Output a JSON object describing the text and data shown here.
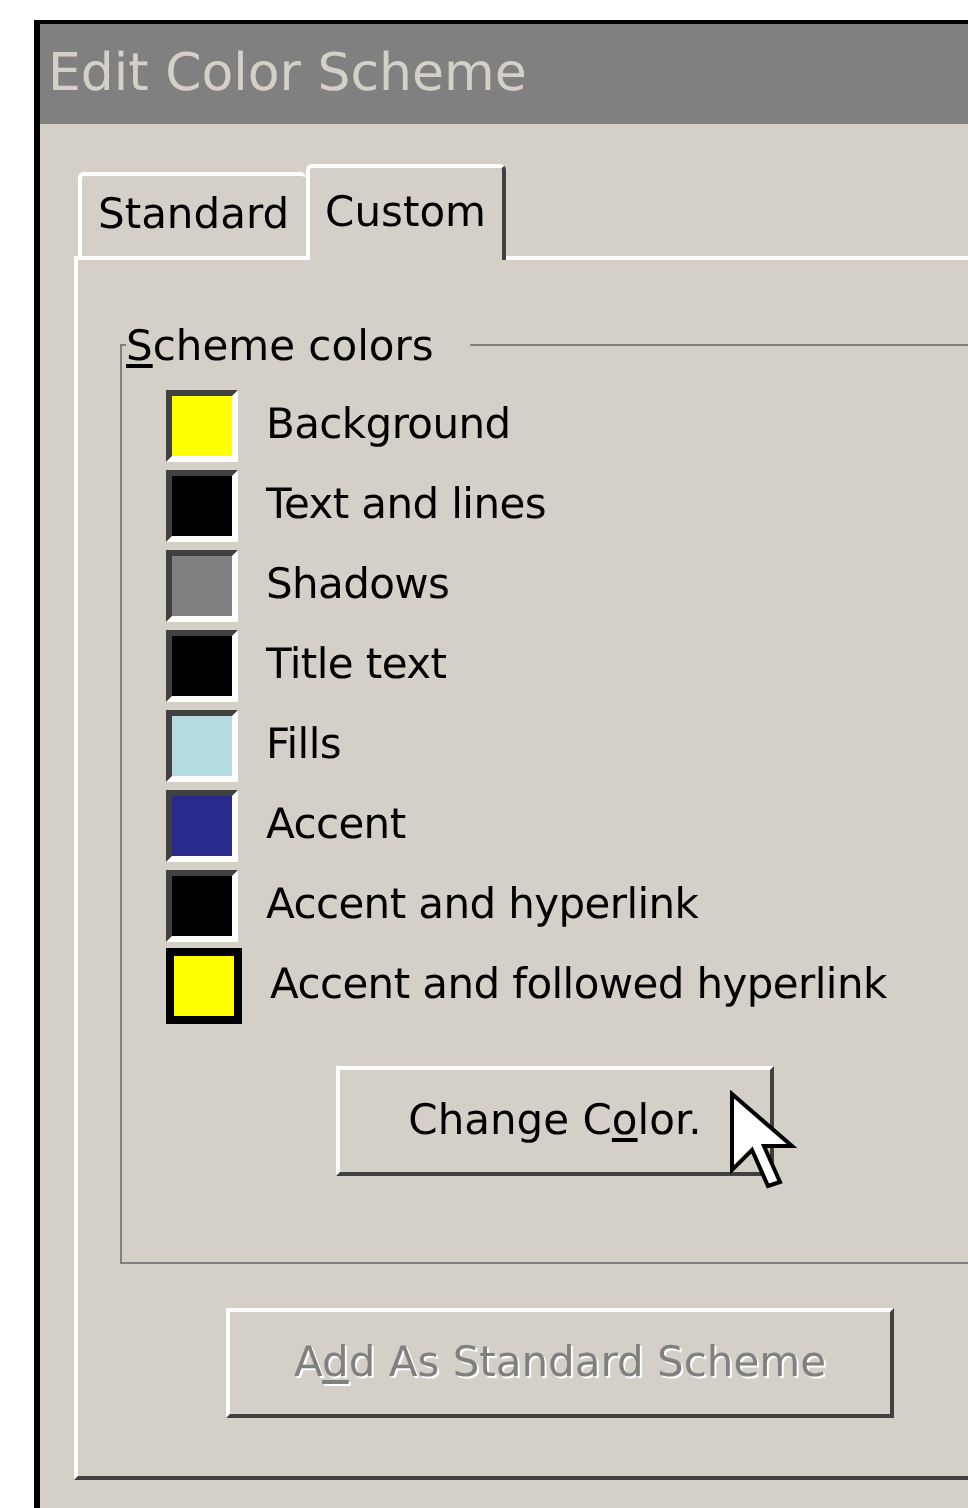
{
  "window": {
    "title": "Edit Color Scheme"
  },
  "tabs": [
    {
      "label": "Standard",
      "selected": false
    },
    {
      "label": "Custom",
      "selected": true
    }
  ],
  "group": {
    "mnemonic": "S",
    "label_after": "cheme colors"
  },
  "scheme_colors": [
    {
      "label": "Background",
      "color": "#ffff00",
      "selected": false
    },
    {
      "label": "Text and lines",
      "color": "#000000",
      "selected": false
    },
    {
      "label": "Shadows",
      "color": "#808080",
      "selected": false
    },
    {
      "label": "Title text",
      "color": "#000000",
      "selected": false
    },
    {
      "label": "Fills",
      "color": "#b4dce0",
      "selected": false
    },
    {
      "label": "Accent",
      "color": "#2a2a8c",
      "selected": false
    },
    {
      "label": "Accent and hyperlink",
      "color": "#000000",
      "selected": false
    },
    {
      "label": "Accent and followed hyperlink",
      "color": "#ffff00",
      "selected": true
    }
  ],
  "buttons": [
    {
      "kind": "change",
      "label_before": "Change C",
      "mnemonic": "o",
      "label_after": "lor.",
      "disabled": false
    },
    {
      "kind": "add",
      "label_before": "A",
      "mnemonic": "d",
      "label_after": "d As Standard Scheme",
      "disabled": true
    }
  ]
}
